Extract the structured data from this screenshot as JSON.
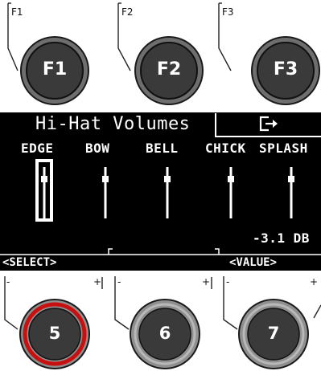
{
  "function_keys": [
    {
      "corner_label": "F1",
      "button_label": "F1"
    },
    {
      "corner_label": "F2",
      "button_label": "F2"
    },
    {
      "corner_label": "F3",
      "button_label": "F3"
    }
  ],
  "screen": {
    "title": "Hi-Hat Volumes",
    "exit_icon": "exit-icon",
    "channels": [
      {
        "label": "EDGE",
        "level": 0.75,
        "selected": true
      },
      {
        "label": "BOW",
        "level": 0.75,
        "selected": false
      },
      {
        "label": "BELL",
        "level": 0.75,
        "selected": false
      },
      {
        "label": "CHICK",
        "level": 0.75,
        "selected": false
      },
      {
        "label": "SPLASH",
        "level": 0.75,
        "selected": false
      }
    ],
    "value_readout": "-3.1 DB",
    "footer_left": "<SELECT>",
    "footer_right": "<VALUE>"
  },
  "encoders": [
    {
      "number": "5",
      "minus": "-",
      "plus": "+",
      "active": true
    },
    {
      "number": "6",
      "minus": "-",
      "plus": "+",
      "active": false
    },
    {
      "number": "7",
      "minus": "-",
      "plus": "+",
      "active": false
    }
  ],
  "colors": {
    "screen_bg": "#000000",
    "knob_dark": "#3a3a3a",
    "knob_ring": "#8a8a8a",
    "active_ring": "#d01010"
  }
}
